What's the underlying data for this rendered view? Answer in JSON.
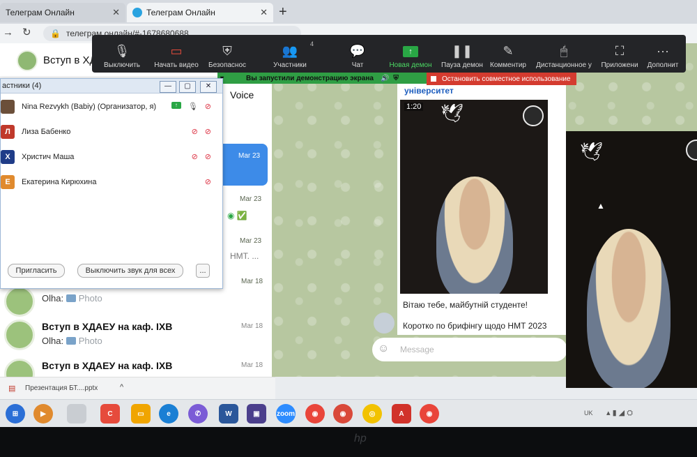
{
  "browser": {
    "tabs": [
      {
        "label": "Телеграм Онлайн"
      },
      {
        "label": "Телеграм Онлайн"
      }
    ],
    "url": "телеграм.онлайн/#-1678680688"
  },
  "telegram": {
    "header": {
      "title": "Вступ в ХДА"
    },
    "column_header": "Voice",
    "chats": [
      {
        "name": "",
        "sender": "Olha:",
        "preview": "Photo",
        "date": "Mar 18"
      },
      {
        "name": "Вступ в ХДАЕУ на каф. ІХВ",
        "sender": "Olha:",
        "preview": "Photo",
        "date": "Mar 18"
      },
      {
        "name": "Вступ в ХДАЕУ на каф. ІХВ",
        "sender": "",
        "preview": "",
        "date": "Mar 18"
      }
    ],
    "col_dates": [
      "Mar 23",
      "Mar 23",
      "Mar 23",
      "Mar 18"
    ],
    "col_snippet": "НМТ. ...",
    "channel_title": "університет",
    "video_time": "1:20",
    "messages": [
      "Вітаю тебе, майбутній студенте!",
      "Коротко по брифінгу щодо НМТ 2023"
    ],
    "compose_placeholder": "Message"
  },
  "zoom": {
    "toolbar": [
      {
        "label": "Выключить",
        "icon": "mic-icon"
      },
      {
        "label": "Начать видео",
        "icon": "video-off-icon"
      },
      {
        "label": "Безопаснос",
        "icon": "shield-icon"
      },
      {
        "label": "Участники",
        "icon": "participants-icon",
        "count": "4"
      },
      {
        "label": "Чат",
        "icon": "chat-icon"
      },
      {
        "label": "Новая демон",
        "icon": "share-screen-icon"
      },
      {
        "label": "Пауза демон",
        "icon": "pause-icon"
      },
      {
        "label": "Комментир",
        "icon": "pen-icon"
      },
      {
        "label": "Дистанционное у",
        "icon": "mouse-icon"
      },
      {
        "label": "Приложени",
        "icon": "apps-icon"
      },
      {
        "label": "Дополнит",
        "icon": "more-icon"
      }
    ],
    "share_notice": "Вы запустили демонстрацию экрана",
    "stop_share": "Остановить совместное использование",
    "participants_window": {
      "title": "астники (4)",
      "participants": [
        {
          "name": "Nina Rezvykh (Babiy) (Организатор, я)",
          "initial": "",
          "color": "#6b4f3a"
        },
        {
          "name": "Лиза Бабенко",
          "initial": "Л",
          "color": "#c0392b"
        },
        {
          "name": "Христич Маша",
          "initial": "Х",
          "color": "#1f3c88"
        },
        {
          "name": "Екатерина Кирюхина",
          "initial": "Е",
          "color": "#e08a2e"
        }
      ],
      "invite_label": "Пригласить",
      "mute_all_label": "Выключить звук для всех",
      "more_label": "..."
    }
  },
  "download_bar": {
    "file": "Презентация БТ....pptx"
  },
  "taskbar": {
    "zoom_label": "zoom",
    "lang": "UK"
  }
}
